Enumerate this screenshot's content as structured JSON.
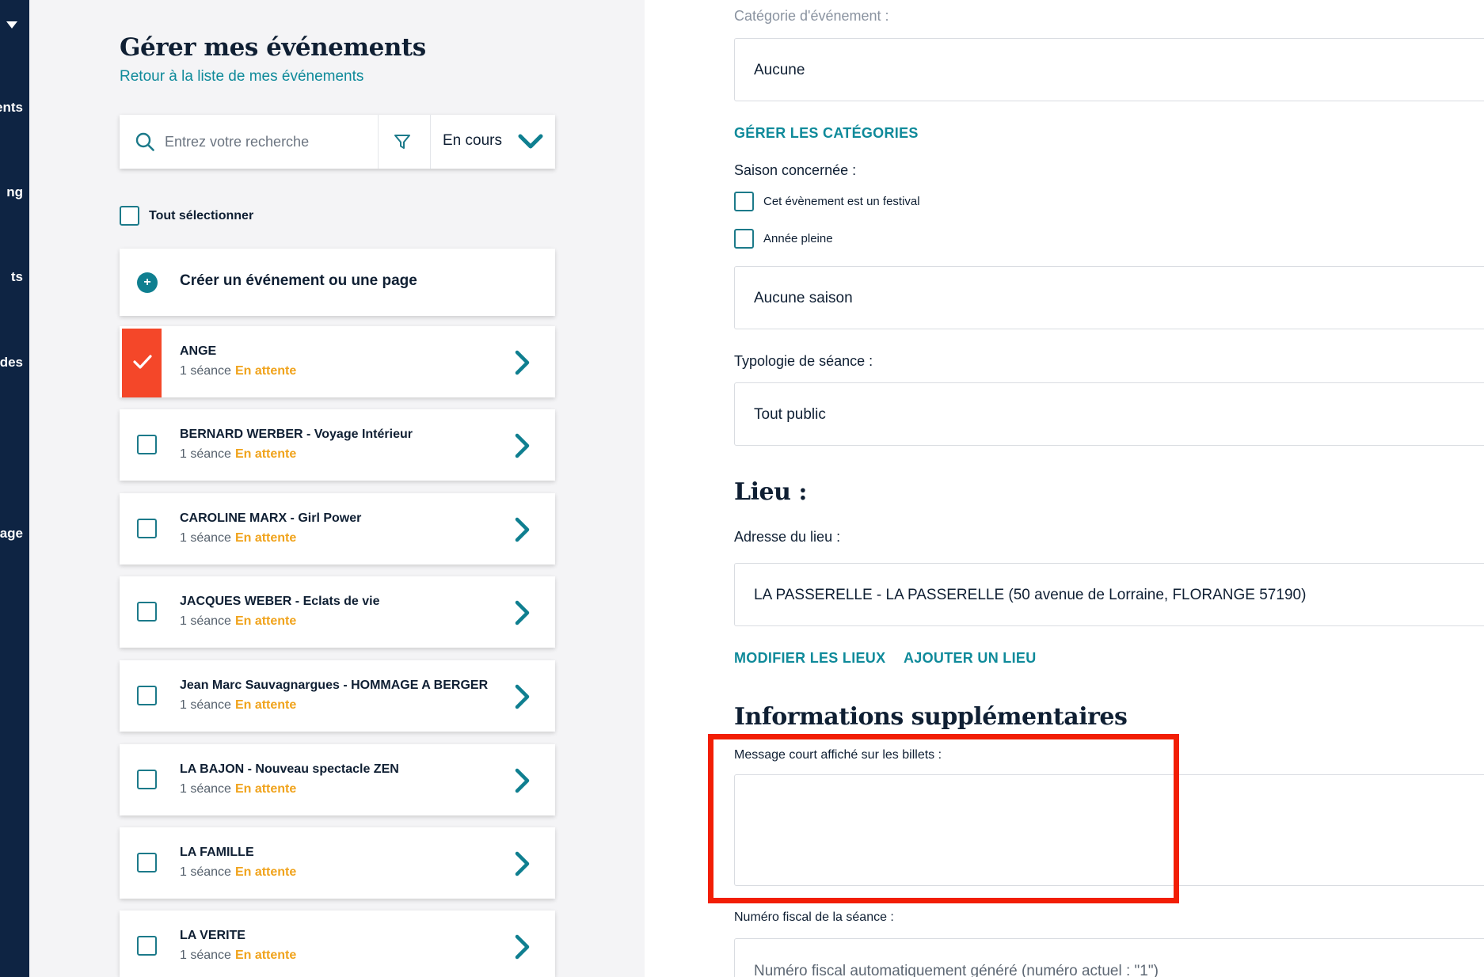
{
  "sidenav": {
    "items": [
      "ents",
      "ng",
      "ts",
      "des",
      "rage"
    ]
  },
  "header": {
    "title": "Gérer mes événements",
    "back_link": "Retour à la liste de mes événements"
  },
  "search": {
    "placeholder": "Entrez votre recherche",
    "status_filter": "En cours"
  },
  "select_all_label": "Tout sélectionner",
  "create_label": "Créer un événement ou une page",
  "events": [
    {
      "title": "ANGE",
      "sessions": "1 séance",
      "status": "En attente",
      "selected": true
    },
    {
      "title": "BERNARD WERBER - Voyage Intérieur",
      "sessions": "1 séance",
      "status": "En attente",
      "selected": false
    },
    {
      "title": "CAROLINE MARX - Girl Power",
      "sessions": "1 séance",
      "status": "En attente",
      "selected": false
    },
    {
      "title": "JACQUES WEBER - Eclats de vie",
      "sessions": "1 séance",
      "status": "En attente",
      "selected": false
    },
    {
      "title": "Jean Marc Sauvagnargues - HOMMAGE A BERGER",
      "sessions": "1 séance",
      "status": "En attente",
      "selected": false
    },
    {
      "title": "LA BAJON - Nouveau spectacle ZEN",
      "sessions": "1 séance",
      "status": "En attente",
      "selected": false
    },
    {
      "title": "LA FAMILLE",
      "sessions": "1 séance",
      "status": "En attente",
      "selected": false
    },
    {
      "title": "LA VERITE",
      "sessions": "1 séance",
      "status": "En attente",
      "selected": false
    }
  ],
  "form": {
    "category_label": "Catégorie d'événement :",
    "category_value": "Aucune",
    "manage_categories": "GÉRER LES CATÉGORIES",
    "season_label": "Saison concernée :",
    "festival_option": "Cet évènement est un festival",
    "full_year_option": "Année pleine",
    "season_value": "Aucune saison",
    "typology_label": "Typologie de séance :",
    "typology_value": "Tout public",
    "venue_heading": "Lieu :",
    "address_label": "Adresse du lieu :",
    "address_value": "LA PASSERELLE - LA PASSERELLE (50 avenue de Lorraine, FLORANGE 57190)",
    "edit_venues": "MODIFIER LES LIEUX",
    "add_venue": "AJOUTER UN LIEU",
    "extra_heading": "Informations supplémentaires",
    "ticket_message_label": "Message court affiché sur les billets :",
    "ticket_message_value": "",
    "fiscal_label": "Numéro fiscal de la séance :",
    "fiscal_value": "Numéro fiscal automatiquement généré (numéro actuel : \"1\")"
  },
  "colors": {
    "nav_bg": "#0e2443",
    "accent_teal": "#0f8a9a",
    "pending_orange": "#f0a31c",
    "selected_red": "#f44729",
    "highlight_red": "#f21e05"
  }
}
